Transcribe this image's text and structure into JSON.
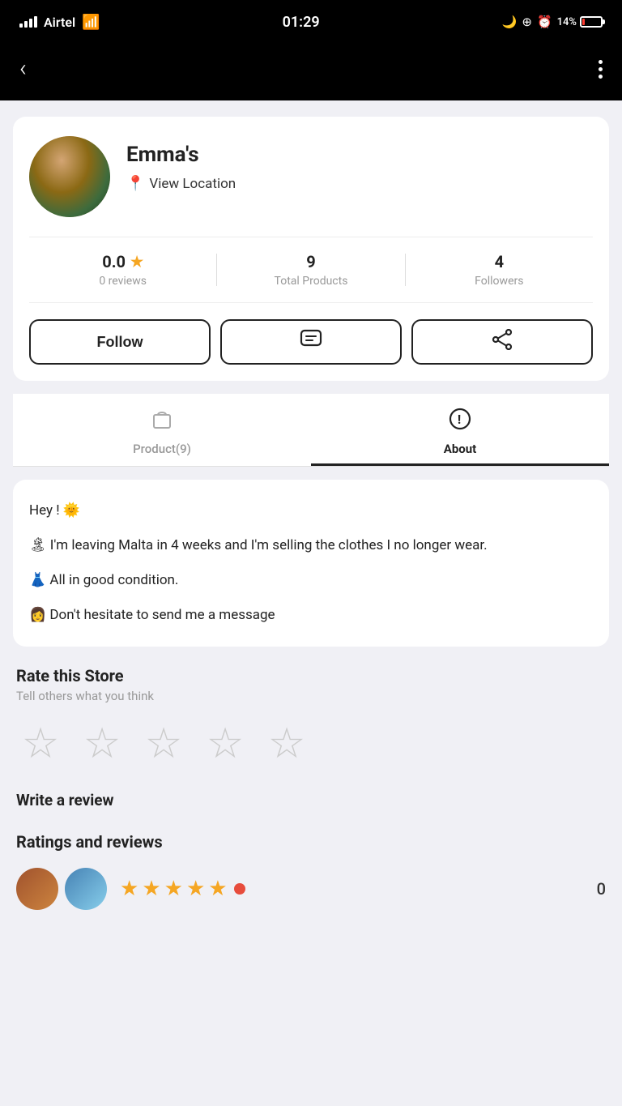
{
  "status_bar": {
    "carrier": "Airtel",
    "time": "01:29",
    "battery_percent": "14%"
  },
  "nav": {
    "back_label": "‹",
    "menu_label": "⋮"
  },
  "profile": {
    "name": "Emma's",
    "location_label": "View Location",
    "rating_value": "0.0",
    "reviews_label": "0 reviews",
    "total_products_value": "9",
    "total_products_label": "Total Products",
    "followers_value": "4",
    "followers_label": "Followers"
  },
  "buttons": {
    "follow_label": "Follow",
    "message_label": "💬",
    "share_label": "⤴"
  },
  "tabs": [
    {
      "id": "products",
      "icon": "🛍",
      "label": "Product(9)",
      "active": false
    },
    {
      "id": "about",
      "icon": "ℹ",
      "label": "About",
      "active": true
    }
  ],
  "about": {
    "lines": [
      "Hey ! 🌞",
      "🏝 I'm leaving Malta in 4 weeks and I'm selling the clothes I no longer wear.",
      "👗 All in good condition.",
      "👩 Don't hesitate to send me a message"
    ]
  },
  "rate_store": {
    "title": "Rate this Store",
    "subtitle": "Tell others what you think",
    "stars": [
      "☆",
      "☆",
      "☆",
      "☆",
      "☆"
    ]
  },
  "write_review": {
    "label": "Write a review"
  },
  "ratings_reviews": {
    "title": "Ratings and reviews",
    "filled_stars": [
      "★",
      "★",
      "★",
      "★",
      "★"
    ],
    "count": "0"
  }
}
